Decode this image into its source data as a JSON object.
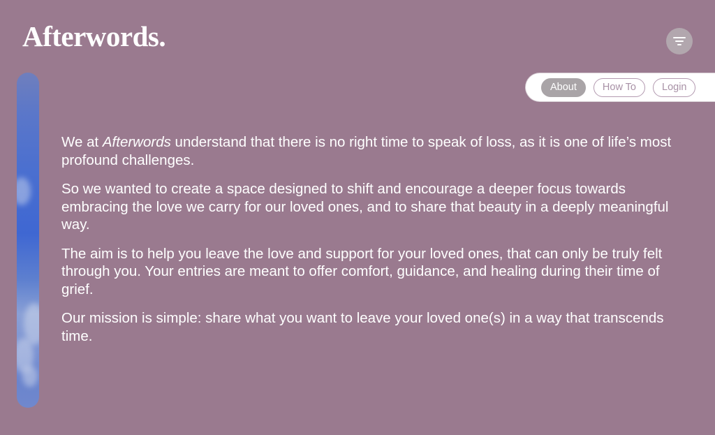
{
  "brand": {
    "logo_text": "Afterwords."
  },
  "header": {
    "filter_icon": "filter-lines-icon"
  },
  "nav": {
    "items": [
      {
        "label": "About",
        "active": true
      },
      {
        "label": "How To",
        "active": false
      },
      {
        "label": "Login",
        "active": false
      }
    ]
  },
  "about": {
    "p1_before": "We at ",
    "p1_em": "Afterwords",
    "p1_after": " understand that there is no right time to speak of loss, as it is one of life’s most profound challenges.",
    "p2": "So we wanted to create a space designed to shift and encourage a deeper focus towards embracing the love we carry for our loved ones, and to share that beauty in a deeply meaningful way.",
    "p3": "The aim is to help you leave the love and support for your loved ones, that can only be truly felt through you. Your entries are meant to offer comfort, guidance, and healing during their time of grief.",
    "p4": "Our mission is simple: share what you want to leave your loved one(s) in a way that transcends time."
  },
  "colors": {
    "background": "#9a7a8f",
    "text": "#ffffff",
    "nav_active": "#a9a4a7",
    "nav_text": "#a891a6",
    "sky_blue": "#4a6fd0"
  }
}
